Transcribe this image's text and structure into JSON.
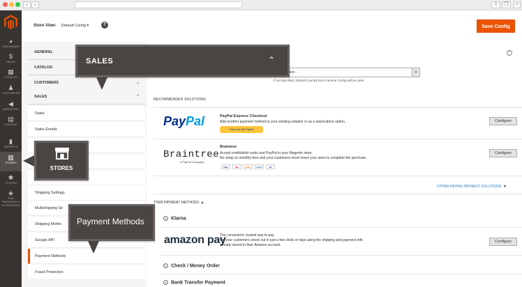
{
  "header": {
    "store_view_label": "Store View:",
    "store_view_value": "Default Config",
    "save_label": "Save Config"
  },
  "admin_nav": [
    {
      "label": "DASHBOARD",
      "icon": "speedometer-icon",
      "glyph": "◕"
    },
    {
      "label": "SALES",
      "icon": "dollar-icon",
      "glyph": "$"
    },
    {
      "label": "CATALOG",
      "icon": "box-icon",
      "glyph": "▦"
    },
    {
      "label": "CUSTOMERS",
      "icon": "person-icon",
      "glyph": "♟"
    },
    {
      "label": "MARKETING",
      "icon": "megaphone-icon",
      "glyph": "◀"
    },
    {
      "label": "CONTENT",
      "icon": "layout-icon",
      "glyph": "▤"
    },
    {
      "label": "REPORTS",
      "icon": "bar-chart-icon",
      "glyph": "▮"
    },
    {
      "label": "STORES",
      "icon": "store-icon",
      "glyph": "▥"
    },
    {
      "label": "SYSTEM",
      "icon": "gear-icon",
      "glyph": "✱"
    },
    {
      "label": "FIND PARTNERS & EXTENSIONS",
      "icon": "cubes-icon",
      "glyph": "◈"
    }
  ],
  "config_nav": {
    "sections": [
      "GENERAL",
      "CATALOG",
      "CUSTOMERS",
      "SALES"
    ],
    "items": [
      "Sales",
      "Sales Emails",
      "Shipping Settings",
      "Multishipping Se",
      "Shipping Metho",
      "Google API",
      "Payment Methods",
      "Fraud Protection"
    ]
  },
  "main": {
    "select_value": "elect--",
    "select_note": "If not specified, Default Country from General Config will be used",
    "recommended_label": "RECOMMENDED SOLUTIONS:",
    "paypal": {
      "logo": "PayPal",
      "title": "PayPal Express Checkout",
      "desc": "Add another payment method to your existing solution or as a stand-alone option.",
      "mini_btn": "Check out with PayPal",
      "configure": "Configure"
    },
    "braintree": {
      "logo": "Braintree",
      "logo_sub": "a PayPal Company",
      "title": "Braintree",
      "desc1": "Accept credit/debit cards and PayPal in your Magento store.",
      "desc2": "No setup or monthly fees and your customers never leave your store to complete the purchase.",
      "cards": [
        "VISA",
        "MC",
        "DISC",
        "AMEX",
        "PP"
      ],
      "configure": "Configure"
    },
    "other_paypal": "OTHER PAYPAL PAYMENT SOLUTIONS:",
    "other_methods": "THER PAYMENT METHODS:",
    "klarna": "Klarna",
    "amazon": {
      "logo": "amazon pay",
      "desc1": "The convenient, trusted way to pay.",
      "desc2": "Let your customers check out in just a few clicks or taps using the shipping and payment info",
      "desc3": "already stored in their Amazon account.",
      "configure": "Configure"
    },
    "check_money": "Check / Money Order",
    "bank_transfer": "Bank Transfer Payment"
  },
  "callouts": {
    "sales": "SALES",
    "stores": "STORES",
    "payment": "Payment Methods"
  },
  "colors": {
    "accent": "#eb5202",
    "nav_bg": "#373330",
    "callout_bg": "#4a4542"
  }
}
